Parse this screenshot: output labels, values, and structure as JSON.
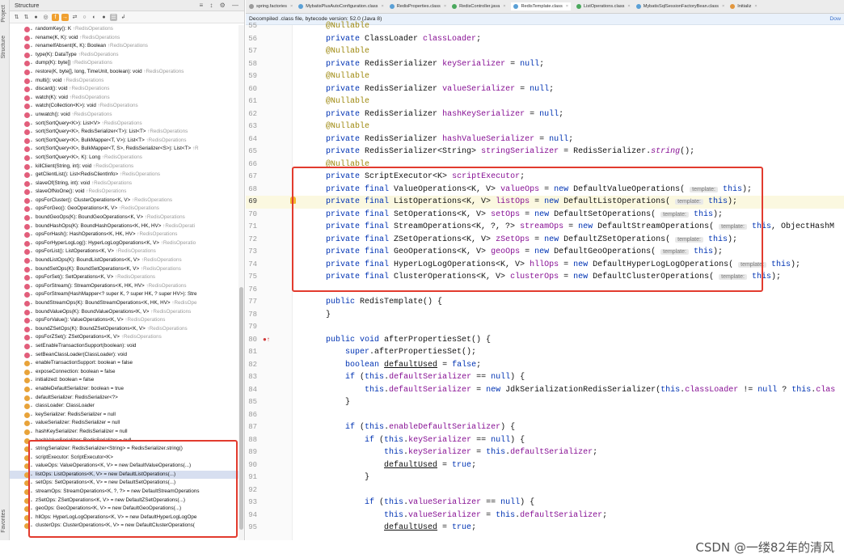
{
  "left_gutter": {
    "project_tab": "Project",
    "structure_tab": "Structure",
    "favorites_tab": "Favorites"
  },
  "structure_panel": {
    "title": "Structure",
    "header_icons": "≡ ↕ ⚙ —",
    "toolbar": [
      "⇅",
      "⇅",
      "●",
      "◎",
      "f",
      "→",
      "⇄",
      "○",
      "◐",
      "●",
      "☰",
      "↲"
    ],
    "items": [
      {
        "kind": "m",
        "name": "randomKey(): K",
        "inherited": "↑RedisOperations"
      },
      {
        "kind": "m",
        "name": "rename(K, K): void",
        "inherited": "↑RedisOperations"
      },
      {
        "kind": "m",
        "name": "renameIfAbsent(K, K): Boolean",
        "inherited": "↑RedisOperations"
      },
      {
        "kind": "m",
        "name": "type(K): DataType",
        "inherited": "↑RedisOperations"
      },
      {
        "kind": "m",
        "name": "dump(K): byte[]",
        "inherited": "↑RedisOperations"
      },
      {
        "kind": "m",
        "name": "restore(K, byte[], long, TimeUnit, boolean): void",
        "inherited": "↑RedisOperations"
      },
      {
        "kind": "m",
        "name": "multi(): void",
        "inherited": "↑RedisOperations"
      },
      {
        "kind": "m",
        "name": "discard(): void",
        "inherited": "↑RedisOperations"
      },
      {
        "kind": "m",
        "name": "watch(K): void",
        "inherited": "↑RedisOperations"
      },
      {
        "kind": "m",
        "name": "watch(Collection<K>): void",
        "inherited": "↑RedisOperations"
      },
      {
        "kind": "m",
        "name": "unwatch(): void",
        "inherited": "↑RedisOperations"
      },
      {
        "kind": "m",
        "name": "sort(SortQuery<K>): List<V>",
        "inherited": "↑RedisOperations"
      },
      {
        "kind": "m",
        "name": "sort(SortQuery<K>, RedisSerializer<T>): List<T>",
        "inherited": "↑RedisOperations"
      },
      {
        "kind": "m",
        "name": "sort(SortQuery<K>, BulkMapper<T, V>): List<T>",
        "inherited": "↑RedisOperations"
      },
      {
        "kind": "m",
        "name": "sort(SortQuery<K>, BulkMapper<T, S>, RedisSerializer<S>): List<T>",
        "inherited": "↑R"
      },
      {
        "kind": "m",
        "name": "sort(SortQuery<K>, K): Long",
        "inherited": "↑RedisOperations"
      },
      {
        "kind": "m",
        "name": "killClient(String, int): void",
        "inherited": "↑RedisOperations"
      },
      {
        "kind": "m",
        "name": "getClientList(): List<RedisClientInfo>",
        "inherited": "↑RedisOperations"
      },
      {
        "kind": "m",
        "name": "slaveOf(String, int): void",
        "inherited": "↑RedisOperations"
      },
      {
        "kind": "m",
        "name": "slaveOfNoOne(): void",
        "inherited": "↑RedisOperations"
      },
      {
        "kind": "m",
        "name": "opsForCluster(): ClusterOperations<K, V>",
        "inherited": "↑RedisOperations"
      },
      {
        "kind": "m",
        "name": "opsForGeo(): GeoOperations<K, V>",
        "inherited": "↑RedisOperations"
      },
      {
        "kind": "m",
        "name": "boundGeoOps(K): BoundGeoOperations<K, V>",
        "inherited": "↑RedisOperations"
      },
      {
        "kind": "m",
        "name": "boundHashOps(K): BoundHashOperations<K, HK, HV>",
        "inherited": "↑RedisOperati"
      },
      {
        "kind": "m",
        "name": "opsForHash(): HashOperations<K, HK, HV>",
        "inherited": "↑RedisOperations"
      },
      {
        "kind": "m",
        "name": "opsForHyperLogLog(): HyperLogLogOperations<K, V>",
        "inherited": "↑RedisOperatio"
      },
      {
        "kind": "m",
        "name": "opsForList(): ListOperations<K, V>",
        "inherited": "↑RedisOperations"
      },
      {
        "kind": "m",
        "name": "boundListOps(K): BoundListOperations<K, V>",
        "inherited": "↑RedisOperations"
      },
      {
        "kind": "m",
        "name": "boundSetOps(K): BoundSetOperations<K, V>",
        "inherited": "↑RedisOperations"
      },
      {
        "kind": "m",
        "name": "opsForSet(): SetOperations<K, V>",
        "inherited": "↑RedisOperations"
      },
      {
        "kind": "m",
        "name": "opsForStream(): StreamOperations<K, HK, HV>",
        "inherited": "↑RedisOperations"
      },
      {
        "kind": "m",
        "name": "opsForStream(HashMapper<? super K, ? super HK, ? super HV>): Stre",
        "inherited": ""
      },
      {
        "kind": "m",
        "name": "boundStreamOps(K): BoundStreamOperations<K, HK, HV>",
        "inherited": "↑RedisOpe"
      },
      {
        "kind": "m",
        "name": "boundValueOps(K): BoundValueOperations<K, V>",
        "inherited": "↑RedisOperations"
      },
      {
        "kind": "m",
        "name": "opsForValue(): ValueOperations<K, V>",
        "inherited": "↑RedisOperations"
      },
      {
        "kind": "m",
        "name": "boundZSetOps(K): BoundZSetOperations<K, V>",
        "inherited": "↑RedisOperations"
      },
      {
        "kind": "m",
        "name": "opsForZSet(): ZSetOperations<K, V>",
        "inherited": "↑RedisOperations"
      },
      {
        "kind": "m",
        "name": "setEnableTransactionSupport(boolean): void",
        "inherited": ""
      },
      {
        "kind": "m",
        "name": "setBeanClassLoader(ClassLoader): void",
        "inherited": ""
      },
      {
        "kind": "f",
        "name": "enableTransactionSupport: boolean = false",
        "inherited": ""
      },
      {
        "kind": "f",
        "name": "exposeConnection: boolean = false",
        "inherited": ""
      },
      {
        "kind": "f",
        "name": "initialized: boolean = false",
        "inherited": ""
      },
      {
        "kind": "f",
        "name": "enableDefaultSerializer: boolean = true",
        "inherited": ""
      },
      {
        "kind": "f",
        "name": "defaultSerializer: RedisSerializer<?>",
        "inherited": ""
      },
      {
        "kind": "f",
        "name": "classLoader: ClassLoader",
        "inherited": ""
      },
      {
        "kind": "f",
        "name": "keySerializer: RedisSerializer = null",
        "inherited": ""
      },
      {
        "kind": "f",
        "name": "valueSerializer: RedisSerializer = null",
        "inherited": ""
      },
      {
        "kind": "f",
        "name": "hashKeySerializer: RedisSerializer = null",
        "inherited": ""
      },
      {
        "kind": "f",
        "name": "hashValueSerializer: RedisSerializer = null",
        "inherited": ""
      },
      {
        "kind": "f",
        "name": "stringSerializer: RedisSerializer<String> = RedisSerializer.string()",
        "inherited": ""
      },
      {
        "kind": "f",
        "name": "scriptExecutor: ScriptExecutor<K>",
        "inherited": ""
      },
      {
        "kind": "f",
        "name": "valueOps: ValueOperations<K, V> = new DefaultValueOperations(...)",
        "inherited": ""
      },
      {
        "kind": "f",
        "name": "listOps: ListOperations<K, V> = new DefaultListOperations(...)",
        "inherited": "",
        "selected": true
      },
      {
        "kind": "f",
        "name": "setOps: SetOperations<K, V> = new DefaultSetOperations(...)",
        "inherited": ""
      },
      {
        "kind": "f",
        "name": "streamOps: StreamOperations<K, ?, ?> = new DefaultStreamOperations",
        "inherited": ""
      },
      {
        "kind": "f",
        "name": "zSetOps: ZSetOperations<K, V> = new DefaultZSetOperations(...)",
        "inherited": ""
      },
      {
        "kind": "f",
        "name": "geoOps: GeoOperations<K, V> = new DefaultGeoOperations(...)",
        "inherited": ""
      },
      {
        "kind": "f",
        "name": "hllOps: HyperLogLogOperations<K, V> = new DefaultHyperLogLogOpe",
        "inherited": ""
      },
      {
        "kind": "f",
        "name": "clusterOps: ClusterOperations<K, V> = new DefaultClusterOperations(",
        "inherited": ""
      }
    ]
  },
  "tabs": [
    {
      "label": "spring.factories",
      "color": "gray"
    },
    {
      "label": "MybatisPlusAutoConfiguration.class",
      "color": "blue"
    },
    {
      "label": "RedisProperties.class",
      "color": "blue"
    },
    {
      "label": "RedisController.java",
      "color": "green"
    },
    {
      "label": "RedisTemplate.class",
      "color": "blue",
      "active": true
    },
    {
      "label": "ListOperations.class",
      "color": "green"
    },
    {
      "label": "MybatisSqlSessionFactoryBean.class",
      "color": "blue"
    },
    {
      "label": "Initializ",
      "color": "orange"
    }
  ],
  "notice": {
    "text": "Decompiled .class file, bytecode version: 52.0 (Java 8)",
    "action": "Dow"
  },
  "code": {
    "lines": [
      {
        "n": "55",
        "html": "    <span class=\"an\">@Nullable</span>"
      },
      {
        "n": "56",
        "html": "    <span class=\"kw\">private</span> ClassLoader <span class=\"fd\">classLoader</span>;"
      },
      {
        "n": "57",
        "html": "    <span class=\"an\">@Nullable</span>"
      },
      {
        "n": "58",
        "html": "    <span class=\"kw\">private</span> RedisSerializer <span class=\"fd\">keySerializer</span> = <span class=\"kw\">null</span>;"
      },
      {
        "n": "59",
        "html": "    <span class=\"an\">@Nullable</span>"
      },
      {
        "n": "60",
        "html": "    <span class=\"kw\">private</span> RedisSerializer <span class=\"fd\">valueSerializer</span> = <span class=\"kw\">null</span>;"
      },
      {
        "n": "61",
        "html": "    <span class=\"an\">@Nullable</span>"
      },
      {
        "n": "62",
        "html": "    <span class=\"kw\">private</span> RedisSerializer <span class=\"fd\">hashKeySerializer</span> = <span class=\"kw\">null</span>;"
      },
      {
        "n": "63",
        "html": "    <span class=\"an\">@Nullable</span>"
      },
      {
        "n": "64",
        "html": "    <span class=\"kw\">private</span> RedisSerializer <span class=\"fd\">hashValueSerializer</span> = <span class=\"kw\">null</span>;"
      },
      {
        "n": "65",
        "html": "    <span class=\"kw\">private</span> RedisSerializer&lt;String&gt; <span class=\"fd\">stringSerializer</span> = RedisSerializer.<span class=\"st\">string</span>();"
      },
      {
        "n": "66",
        "html": "    <span class=\"an\">@Nullable</span>"
      },
      {
        "n": "67",
        "html": "    <span class=\"kw\">private</span> ScriptExecutor&lt;K&gt; <span class=\"fd\">scriptExecutor</span>;"
      },
      {
        "n": "68",
        "html": "    <span class=\"kw\">private final</span> ValueOperations&lt;K, V&gt; <span class=\"fd\">valueOps</span> = <span class=\"kw\">new</span> DefaultValueOperations( <span class=\"hint\">template:</span> <span class=\"kw\">this</span>);"
      },
      {
        "n": "69",
        "html": "    <span class=\"kw\">private final</span> ListOperations&lt;K, V&gt; <span class=\"fd\">listOps</span> = <span class=\"kw\">new</span> DefaultListOperations( <span class=\"hint\">template:</span> <span class=\"kw\">this</span>);",
        "hl": true
      },
      {
        "n": "70",
        "html": "    <span class=\"kw\">private final</span> SetOperations&lt;K, V&gt; <span class=\"fd\">setOps</span> = <span class=\"kw\">new</span> DefaultSetOperations( <span class=\"hint\">template:</span> <span class=\"kw\">this</span>);"
      },
      {
        "n": "71",
        "html": "    <span class=\"kw\">private final</span> StreamOperations&lt;K, ?, ?&gt; <span class=\"fd\">streamOps</span> = <span class=\"kw\">new</span> DefaultStreamOperations( <span class=\"hint\">template:</span> <span class=\"kw\">this</span>, ObjectHashM"
      },
      {
        "n": "72",
        "html": "    <span class=\"kw\">private final</span> ZSetOperations&lt;K, V&gt; <span class=\"fd\">zSetOps</span> = <span class=\"kw\">new</span> DefaultZSetOperations( <span class=\"hint\">template:</span> <span class=\"kw\">this</span>);"
      },
      {
        "n": "73",
        "html": "    <span class=\"kw\">private final</span> GeoOperations&lt;K, V&gt; <span class=\"fd\">geoOps</span> = <span class=\"kw\">new</span> DefaultGeoOperations( <span class=\"hint\">template:</span> <span class=\"kw\">this</span>);"
      },
      {
        "n": "74",
        "html": "    <span class=\"kw\">private final</span> HyperLogLogOperations&lt;K, V&gt; <span class=\"fd\">hllOps</span> = <span class=\"kw\">new</span> DefaultHyperLogLogOperations( <span class=\"hint\">template:</span> <span class=\"kw\">this</span>);"
      },
      {
        "n": "75",
        "html": "    <span class=\"kw\">private final</span> ClusterOperations&lt;K, V&gt; <span class=\"fd\">clusterOps</span> = <span class=\"kw\">new</span> DefaultClusterOperations( <span class=\"hint\">template:</span> <span class=\"kw\">this</span>);"
      },
      {
        "n": "76",
        "html": ""
      },
      {
        "n": "77",
        "html": "    <span class=\"kw\">public</span> RedisTemplate() {"
      },
      {
        "n": "78",
        "html": "    }"
      },
      {
        "n": "79",
        "html": ""
      },
      {
        "n": "80",
        "html": "    <span class=\"kw\">public void</span> afterPropertiesSet() {"
      },
      {
        "n": "81",
        "html": "        <span class=\"kw\">super</span>.afterPropertiesSet();"
      },
      {
        "n": "82",
        "html": "        <span class=\"kw\">boolean</span> <span class=\"dv\">defaultUsed</span> = <span class=\"kw\">false</span>;"
      },
      {
        "n": "83",
        "html": "        <span class=\"kw\">if</span> (<span class=\"kw\">this</span>.<span class=\"fd\">defaultSerializer</span> == <span class=\"kw\">null</span>) {"
      },
      {
        "n": "84",
        "html": "            <span class=\"kw\">this</span>.<span class=\"fd\">defaultSerializer</span> = <span class=\"kw\">new</span> JdkSerializationRedisSerializer(<span class=\"kw\">this</span>.<span class=\"fd\">classLoader</span> != <span class=\"kw\">null</span> ? <span class=\"kw\">this</span>.<span class=\"fd\">clas</span>"
      },
      {
        "n": "85",
        "html": "        }"
      },
      {
        "n": "86",
        "html": ""
      },
      {
        "n": "87",
        "html": "        <span class=\"kw\">if</span> (<span class=\"kw\">this</span>.<span class=\"fd\">enableDefaultSerializer</span>) {"
      },
      {
        "n": "88",
        "html": "            <span class=\"kw\">if</span> (<span class=\"kw\">this</span>.<span class=\"fd\">keySerializer</span> == <span class=\"kw\">null</span>) {"
      },
      {
        "n": "89",
        "html": "                <span class=\"kw\">this</span>.<span class=\"fd\">keySerializer</span> = <span class=\"kw\">this</span>.<span class=\"fd\">defaultSerializer</span>;"
      },
      {
        "n": "90",
        "html": "                <span class=\"dv\">defaultUsed</span> = <span class=\"kw\">true</span>;"
      },
      {
        "n": "91",
        "html": "            }"
      },
      {
        "n": "92",
        "html": ""
      },
      {
        "n": "93",
        "html": "            <span class=\"kw\">if</span> (<span class=\"kw\">this</span>.<span class=\"fd\">valueSerializer</span> == <span class=\"kw\">null</span>) {"
      },
      {
        "n": "94",
        "html": "                <span class=\"kw\">this</span>.<span class=\"fd\">valueSerializer</span> = <span class=\"kw\">this</span>.<span class=\"fd\">defaultSerializer</span>;"
      },
      {
        "n": "95",
        "html": "                <span class=\"dv\">defaultUsed</span> = <span class=\"kw\">true</span>;"
      }
    ]
  },
  "watermark": "CSDN @一缕82年的清风",
  "colors": {
    "highlight_box": "#e23b2e",
    "keyword": "#0033b3",
    "annotation": "#9e880d",
    "field": "#871094"
  }
}
